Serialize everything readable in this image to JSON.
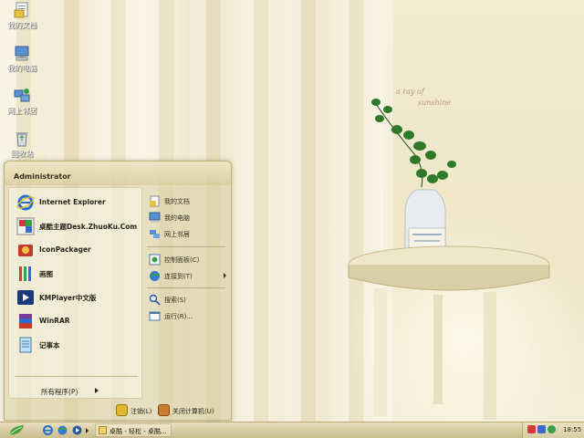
{
  "wallpaper": {
    "tagline_1": "a ray of",
    "tagline_2": "sunshine"
  },
  "desktop_icons": [
    {
      "name": "my-documents",
      "label": "我的文档",
      "icon": "folder-docs-icon"
    },
    {
      "name": "my-computer",
      "label": "我的电脑",
      "icon": "computer-icon"
    },
    {
      "name": "network-places",
      "label": "网上邻居",
      "icon": "network-icon"
    },
    {
      "name": "recycle-bin",
      "label": "回收站",
      "icon": "recycle-bin-icon"
    }
  ],
  "start_menu": {
    "user": "Administrator",
    "programs": [
      {
        "label": "Internet Explorer",
        "icon": "ie-icon"
      },
      {
        "label": "桌酷主题Desk.ZhuoKu.Com",
        "icon": "zhuoku-icon"
      },
      {
        "label": "IconPackager",
        "icon": "iconpackager-icon"
      },
      {
        "label": "画图",
        "icon": "paint-icon"
      },
      {
        "label": "KMPlayer中文版",
        "icon": "kmplayer-icon"
      },
      {
        "label": "WinRAR",
        "icon": "winrar-icon"
      },
      {
        "label": "记事本",
        "icon": "notepad-icon"
      }
    ],
    "all_programs": "所有程序(P)",
    "places": [
      {
        "label": "我的文档",
        "icon": "my-documents-icon"
      },
      {
        "label": "我的电脑",
        "icon": "my-computer-icon"
      },
      {
        "label": "网上邻居",
        "icon": "network-icon"
      },
      {
        "label": "控制面板(C)",
        "icon": "control-panel-icon"
      },
      {
        "label": "连接到(T)",
        "icon": "connect-icon"
      },
      {
        "label": "搜索(S)",
        "icon": "search-icon"
      },
      {
        "label": "运行(R)...",
        "icon": "run-icon"
      }
    ],
    "logoff": "注销(L)",
    "shutdown": "关闭计算机(U)"
  },
  "taskbar": {
    "task_label": "桌酷 - 轻松 - 桌酷...",
    "clock": "18:55"
  },
  "colors": {
    "accent": "#d8cca2",
    "text": "#2b2418"
  }
}
